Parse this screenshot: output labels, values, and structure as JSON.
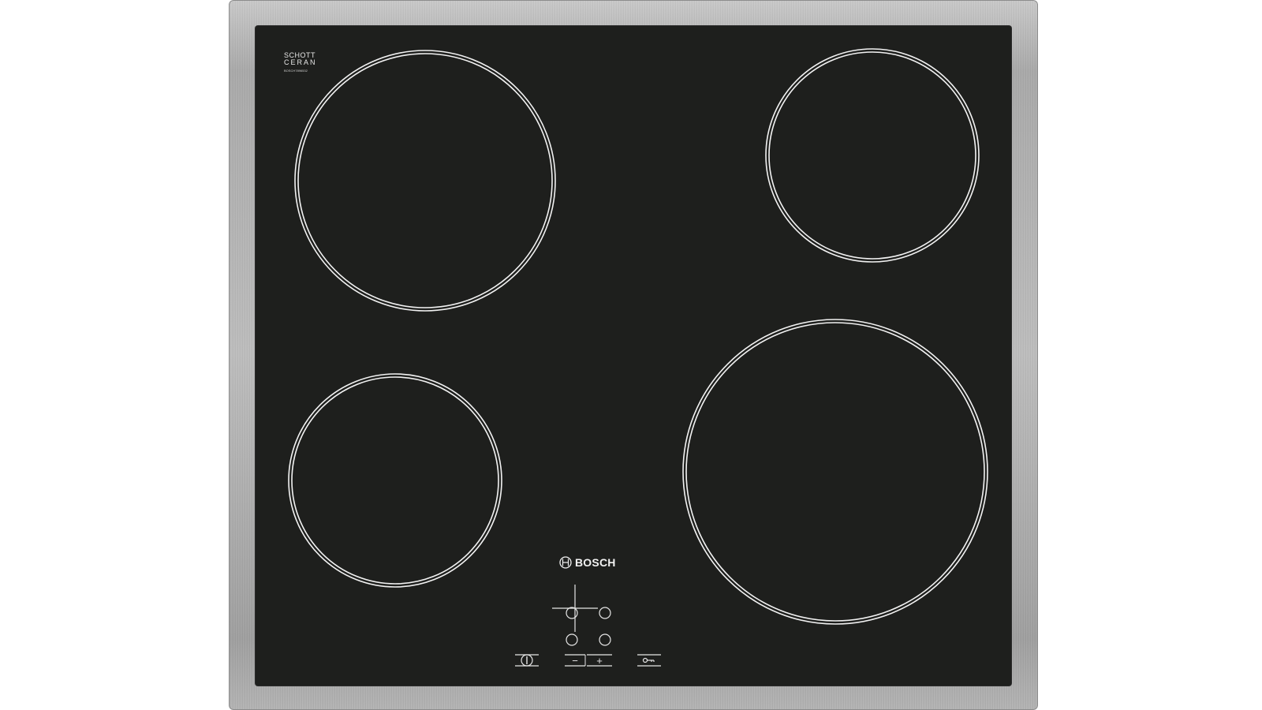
{
  "hob": {
    "brand": "BOSCH",
    "glass_label_line1": "SCHOTT",
    "glass_label_line2": "CERAN",
    "glass_model_text": "BOSCH7896532",
    "frame_color": "#b3b3b3",
    "glass_color": "#1e1f1d",
    "ring_color": "#f5f5f5"
  },
  "controls": {
    "power_icon": "power-icon",
    "zone_selector_icons": [
      "zone-top-left-icon",
      "zone-top-right-icon",
      "zone-bottom-left-icon",
      "zone-bottom-right-icon"
    ],
    "minus_symbol": "−",
    "plus_symbol": "+",
    "lock_icon": "key-lock-icon"
  }
}
